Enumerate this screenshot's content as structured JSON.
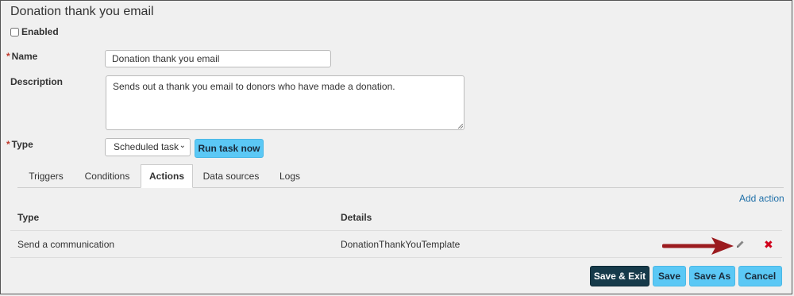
{
  "page": {
    "title": "Donation thank you email"
  },
  "enabled": {
    "label": "Enabled"
  },
  "form": {
    "required_mark": "*",
    "name_label": "Name",
    "name_value": "Donation thank you email",
    "description_label": "Description",
    "description_value": "Sends out a thank you email to donors who have made a donation.",
    "type_label": "Type",
    "type_value": "Scheduled task",
    "run_task_label": "Run task now"
  },
  "tabs": [
    {
      "label": "Triggers"
    },
    {
      "label": "Conditions"
    },
    {
      "label": "Actions"
    },
    {
      "label": "Data sources"
    },
    {
      "label": "Logs"
    }
  ],
  "actions": {
    "add_action_label": "Add action",
    "columns": {
      "type": "Type",
      "details": "Details"
    },
    "rows": [
      {
        "type": "Send a communication",
        "details": "DonationThankYouTemplate"
      }
    ]
  },
  "footer": {
    "save_exit": "Save & Exit",
    "save": "Save",
    "save_as": "Save As",
    "cancel": "Cancel"
  },
  "icons": {
    "edit": "pencil-icon",
    "delete": "delete-x-icon",
    "arrow": "arrow-annotation"
  },
  "colors": {
    "primary_button": "#5bc8f5",
    "dark_button": "#163a4a",
    "link": "#1e6fa8",
    "required": "#c0392b",
    "delete": "#d0021b",
    "arrow": "#9b1b1f"
  }
}
